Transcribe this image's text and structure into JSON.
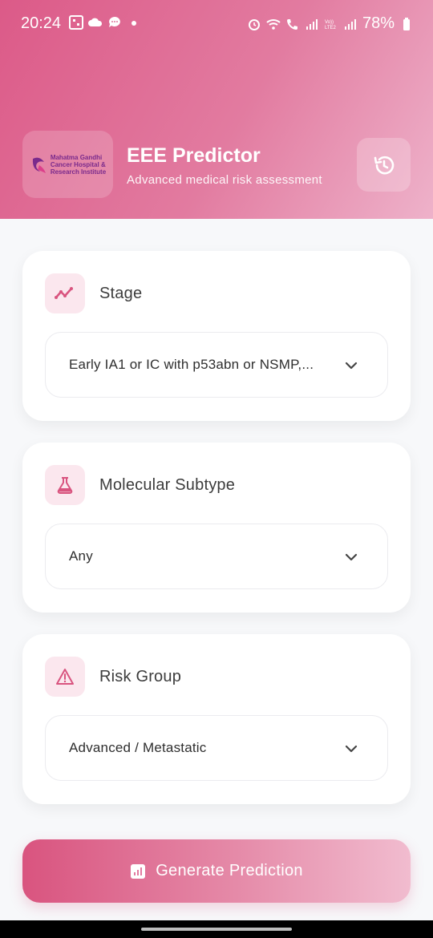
{
  "status_bar": {
    "time": "20:24",
    "battery": "78%",
    "left_icons": [
      "photos-icon",
      "cloud-icon",
      "chat-icon",
      "dot-icon"
    ],
    "right_icons": [
      "alarm-icon",
      "wifi-icon",
      "call-icon",
      "signal-icon",
      "volte-icon",
      "signal-icon",
      "battery-icon"
    ],
    "volte_label": "Vo))\nLTE2"
  },
  "header": {
    "logo_text": "Mahatma Gandhi\nCancer Hospital &\nResearch Institute",
    "title": "EEE Predictor",
    "subtitle": "Advanced medical risk assessment",
    "history_icon": "history-icon"
  },
  "cards": [
    {
      "icon": "trend-chart-icon",
      "title": "Stage",
      "value": "Early IA1 or IC with p53abn or NSMP,..."
    },
    {
      "icon": "flask-icon",
      "title": "Molecular Subtype",
      "value": "Any"
    },
    {
      "icon": "warning-icon",
      "title": "Risk Group",
      "value": "Advanced / Metastatic"
    }
  ],
  "generate_button": {
    "label": "Generate Prediction",
    "icon": "bar-chart-icon"
  },
  "colors": {
    "accent": "#dc5a88",
    "accent_light": "#fbe7ee",
    "icon_pink": "#d9547f"
  }
}
